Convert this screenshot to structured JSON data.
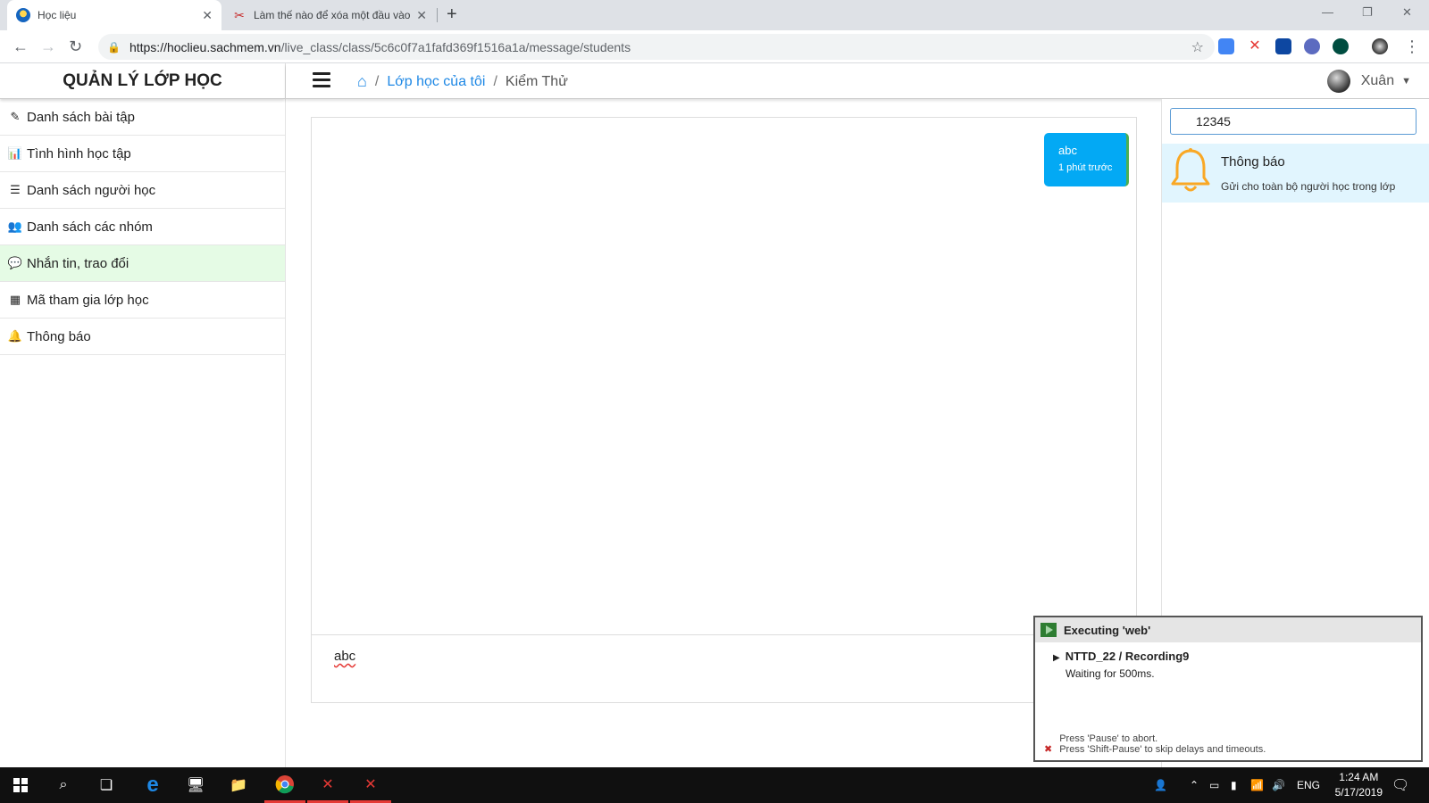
{
  "browser": {
    "tabs": [
      {
        "title": "Học liệu",
        "close": "✕"
      },
      {
        "title": "Làm thế nào để xóa một đầu vào",
        "close": "✕"
      }
    ],
    "new_tab": "+",
    "url_host": "https://hoclieu.sachmem.vn",
    "url_path": "/live_class/class/5c6c0f7a1fafd369f1516a1a/message/students"
  },
  "sidebar": {
    "brand": "QUẢN LÝ LỚP HỌC",
    "items": [
      {
        "label": "Danh sách bài tập",
        "icon": "edit-icon"
      },
      {
        "label": "Tình hình học tập",
        "icon": "bar-chart-icon"
      },
      {
        "label": "Danh sách người học",
        "icon": "list-icon"
      },
      {
        "label": "Danh sách các nhóm",
        "icon": "users-icon"
      },
      {
        "label": "Nhắn tin, trao đổi",
        "icon": "comment-icon",
        "active": true
      },
      {
        "label": "Mã tham gia lớp học",
        "icon": "qrcode-icon"
      },
      {
        "label": "Thông báo",
        "icon": "bell-icon"
      }
    ]
  },
  "topbar": {
    "breadcrumb_link": "Lớp học của tôi",
    "breadcrumb_current": "Kiểm Thử",
    "separator": "/",
    "user_name": "Xuân"
  },
  "chat": {
    "messages": [
      {
        "text": "abc",
        "time": "1 phút trước"
      }
    ],
    "compose_value": "abc"
  },
  "right_panel": {
    "search_value": "12345",
    "notice_title": "Thông báo",
    "notice_subtitle": "Gửi cho toàn bộ người học trong lớp"
  },
  "overlay": {
    "title": "Executing 'web'",
    "recording": "NTTD_22 / Recording9",
    "status": "Waiting for 500ms.",
    "hint1": "Press 'Pause' to abort.",
    "hint2": "Press 'Shift-Pause' to skip delays and timeouts."
  },
  "taskbar": {
    "lang": "ENG",
    "time": "1:24 AM",
    "date": "5/17/2019"
  },
  "colors": {
    "accent": "#1e88e5",
    "bubble": "#03a9f4",
    "active_menu": "#e5fbe5",
    "notice_bg": "#e1f5fe"
  }
}
